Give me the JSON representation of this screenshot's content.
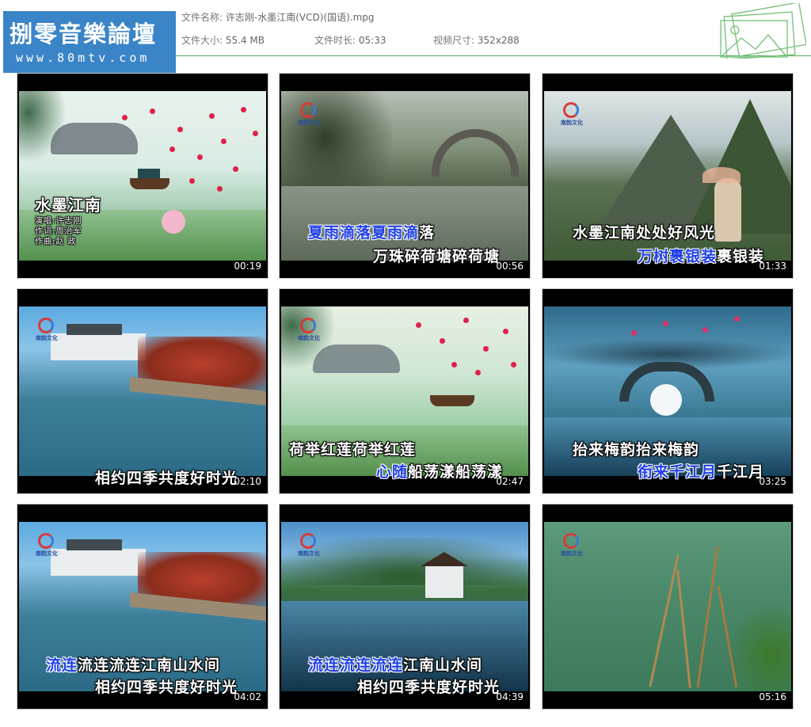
{
  "header": {
    "logo_title": "捌零音樂論壇",
    "logo_url": "www.80mtv.com",
    "file_name_label": "文件名称:",
    "file_name": "许志刚-水墨江南(VCD)(国语).mpg",
    "file_size_label": "文件大小:",
    "file_size": "55.4 MB",
    "duration_label": "文件时长:",
    "duration": "05:33",
    "video_size_label": "视频尺寸:",
    "video_size": "352x288"
  },
  "station_logo_text": "南韵文化",
  "thumbnails": [
    {
      "time": "00:19",
      "title_text": "水墨江南",
      "credits": [
        "演唱:许志刚",
        "作词:周治军",
        "作曲:赵  政"
      ],
      "lines": []
    },
    {
      "time": "00:56",
      "lines": [
        {
          "hl": "夏雨滴落夏雨滴",
          "rest": "落"
        },
        {
          "hl": "",
          "rest": "万珠碎荷塘碎荷塘"
        }
      ]
    },
    {
      "time": "01:33",
      "lines": [
        {
          "hl": "",
          "rest": "水墨江南处处好风光"
        },
        {
          "hl": "万树裹银装",
          "rest": "裹银装"
        }
      ]
    },
    {
      "time": "02:10",
      "lines": [
        {
          "hl": "",
          "rest": "相约四季共度好时光"
        }
      ]
    },
    {
      "time": "02:47",
      "lines": [
        {
          "hl": "",
          "rest": "荷举红莲荷举红莲"
        },
        {
          "hl": "心随",
          "rest": "船荡漾船荡漾"
        }
      ]
    },
    {
      "time": "03:25",
      "lines": [
        {
          "hl": "",
          "rest": "抬来梅韵抬来梅韵"
        },
        {
          "hl": "衔来千江月",
          "rest": "千江月"
        }
      ]
    },
    {
      "time": "04:02",
      "lines": [
        {
          "hl": "流连",
          "rest": "流连流连江南山水间"
        },
        {
          "hl": "",
          "rest": "相约四季共度好时光"
        }
      ]
    },
    {
      "time": "04:39",
      "lines": [
        {
          "hl": "流连流连流连",
          "rest": "江南山水间"
        },
        {
          "hl": "",
          "rest": "相约四季共度好时光"
        }
      ]
    },
    {
      "time": "05:16",
      "lines": []
    }
  ]
}
